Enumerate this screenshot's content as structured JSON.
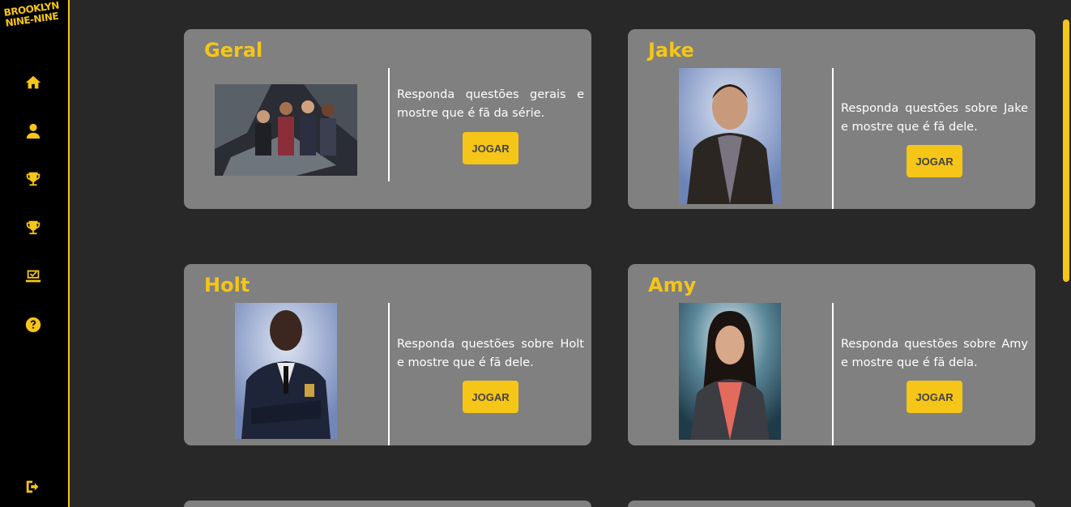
{
  "logo": {
    "line1": "BROOKLYN",
    "line2": "NINE-NINE"
  },
  "nav": [
    {
      "icon": "home-icon"
    },
    {
      "icon": "user-icon"
    },
    {
      "icon": "trophy-icon"
    },
    {
      "icon": "trophy-icon"
    },
    {
      "icon": "inbox-check-icon"
    },
    {
      "icon": "help-icon"
    },
    {
      "icon": "logout-icon"
    }
  ],
  "cards": [
    {
      "title": "Geral",
      "desc": "Responda questões gerais e mostre que é fã da série.",
      "button": "JOGAR"
    },
    {
      "title": "Jake",
      "desc": "Responda questões sobre Jake e mostre que é fã dele.",
      "button": "JOGAR"
    },
    {
      "title": "Holt",
      "desc": "Responda questões sobre Holt e mostre que é fã dele.",
      "button": "JOGAR"
    },
    {
      "title": "Amy",
      "desc": "Responda questões sobre Amy e mostre que é fã dela.",
      "button": "JOGAR"
    }
  ],
  "colors": {
    "accent": "#f5c518",
    "card": "#808080",
    "background": "#282828",
    "sidebar": "#000000"
  }
}
